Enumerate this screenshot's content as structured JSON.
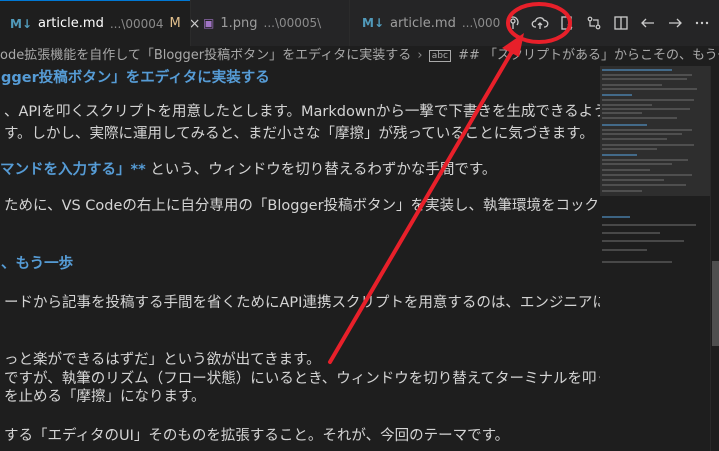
{
  "tabs": [
    {
      "icon": "M↓",
      "name": "article.md",
      "path": "...\\00004",
      "modified": "M",
      "close": "×",
      "active": true
    },
    {
      "icon": "▣",
      "name": "1.png",
      "path": "...\\00005\\",
      "active": false
    },
    {
      "icon": "M↓",
      "name": "article.md",
      "path": "...\\00005",
      "active": false
    }
  ],
  "actions": [
    "podcast-icon",
    "cloud-upload-icon",
    "open-preview-icon",
    "compare-changes-icon",
    "split-editor-icon",
    "go-back-icon",
    "go-forward-icon",
    "more-actions-icon"
  ],
  "breadcrumb": {
    "part1": "ode拡張機能を自作して「Blogger投稿ボタン」をエディタに実装する",
    "sep": "›",
    "heading_icon": "abc",
    "part2": "## 「スクリプトがある」からこその、もう一歩"
  },
  "editor": {
    "lines": [
      {
        "text": "gger投稿ボタン」をエディタに実装する",
        "style": "heading"
      },
      {
        "text": "、APIを叩くスクリプトを用意したとします。Markdownから一撃で下書きを生成できるよう"
      },
      {
        "text": "す。しかし、実際に運用してみると、まだ小さな「摩擦」が残っていることに気づきます。"
      },
      {
        "bold": "マンドを入力する」**",
        "text": " という、ウィンドウを切り替えるわずかな手間です。"
      },
      {
        "text": "ために、VS Codeの右上に自分専用の「Blogger投稿ボタン」を実装し、執筆環境をコックピッ"
      },
      {
        "text": "、もう一歩",
        "style": "heading"
      },
      {
        "text": "ードから記事を投稿する手間を省くためにAPI連携スクリプトを用意するのは、エンジニアにと"
      },
      {
        "text": "っと楽ができるはずだ」という欲が出てきます。"
      },
      {
        "text": "ですが、執筆のリズム（フロー状態）にいるとき、ウィンドウを切り替えてターミナルを叩く"
      },
      {
        "text": "を止める「摩擦」になります。"
      },
      {
        "text": "する「エディタのUI」そのものを拡張すること。それが、今回のテーマです。"
      }
    ]
  },
  "colors": {
    "background": "#1e1e1e",
    "tabbar": "#252526",
    "heading": "#569cd6",
    "md_icon": "#519aba",
    "modified": "#e2c08d",
    "image_icon": "#a074c4",
    "annotation": "#e8202a"
  }
}
